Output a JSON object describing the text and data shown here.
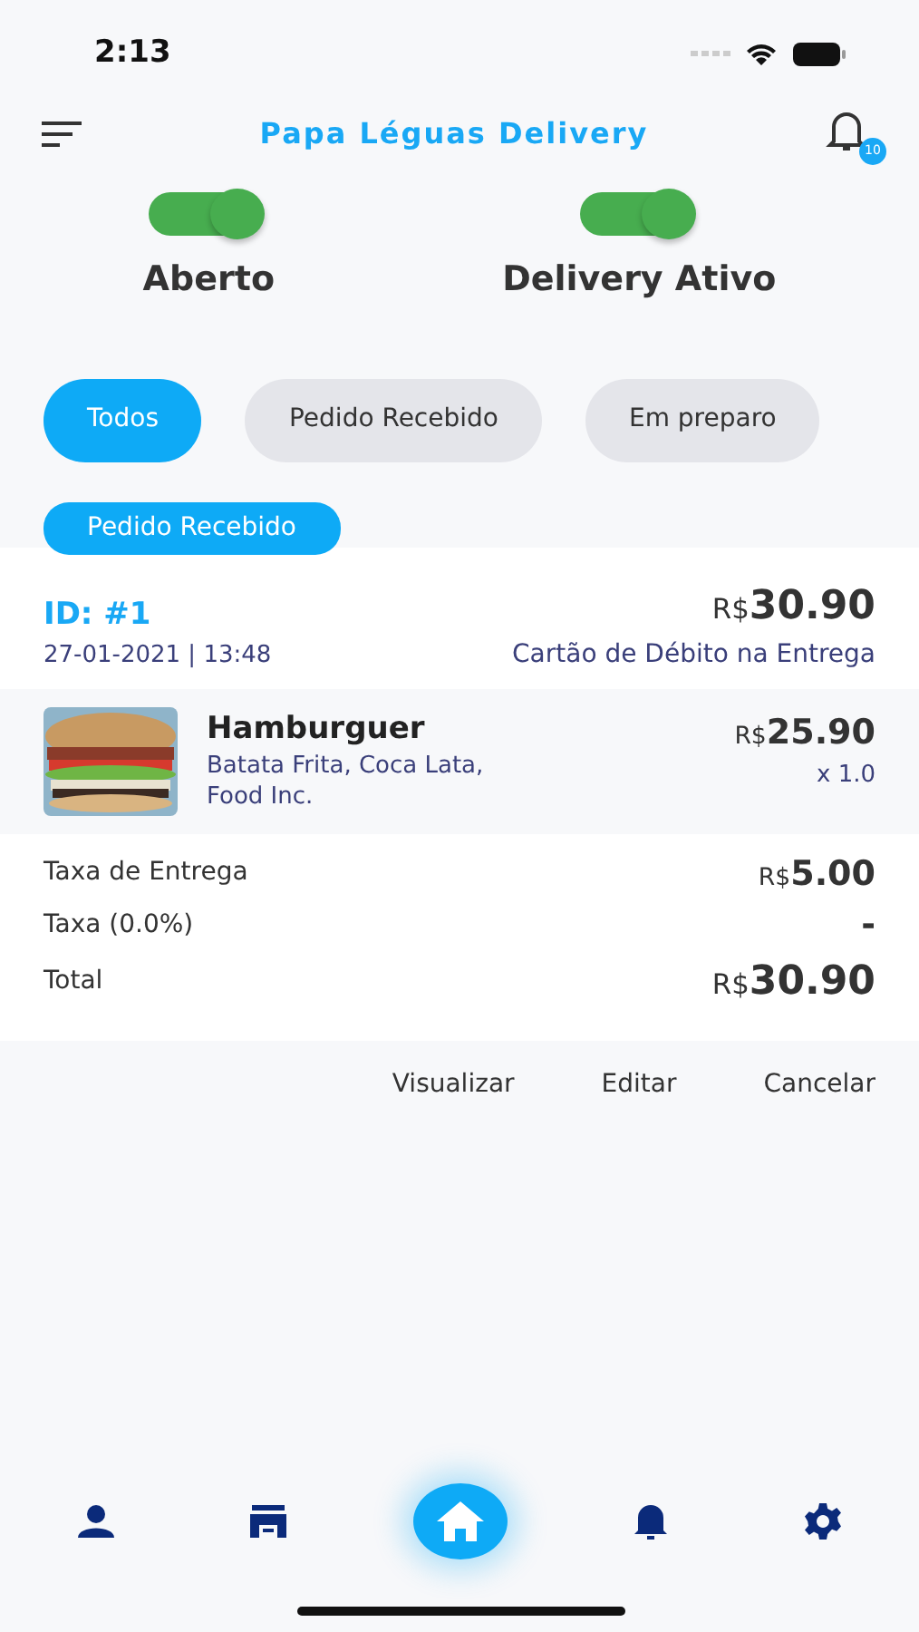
{
  "status_bar": {
    "time": "2:13"
  },
  "header": {
    "title": "Papa Léguas Delivery",
    "notification_count": "10"
  },
  "toggles": [
    {
      "label": "Aberto",
      "on": true
    },
    {
      "label": "Delivery Ativo",
      "on": true
    }
  ],
  "filters": [
    {
      "label": "Todos",
      "selected": true
    },
    {
      "label": "Pedido Recebido",
      "selected": false
    },
    {
      "label": "Em preparo",
      "selected": false
    }
  ],
  "order": {
    "status": "Pedido Recebido",
    "id": "ID: #1",
    "datetime": "27-01-2021 | 13:48",
    "total": {
      "currency": "R$",
      "amount": "30.90"
    },
    "payment": "Cartão de Débito na Entrega",
    "items": [
      {
        "name": "Hamburguer",
        "extras": "Batata Frita, Coca Lata, Food Inc.",
        "price": {
          "currency": "R$",
          "amount": "25.90"
        },
        "quantity": "x 1.0"
      }
    ],
    "summary": [
      {
        "label": "Taxa de Entrega",
        "value": {
          "currency": "R$",
          "amount": "5.00"
        }
      },
      {
        "label": "Taxa (0.0%)",
        "value": {
          "amount": "-"
        }
      },
      {
        "label": "Total",
        "value": {
          "currency": "R$",
          "amount": "30.90"
        }
      }
    ],
    "actions": [
      "Visualizar",
      "Editar",
      "Cancelar"
    ]
  },
  "bottom_nav": [
    {
      "kind": "profile",
      "selected": false
    },
    {
      "kind": "store",
      "selected": false
    },
    {
      "kind": "home",
      "selected": true
    },
    {
      "kind": "bell",
      "selected": false
    },
    {
      "kind": "settings",
      "selected": false
    }
  ]
}
